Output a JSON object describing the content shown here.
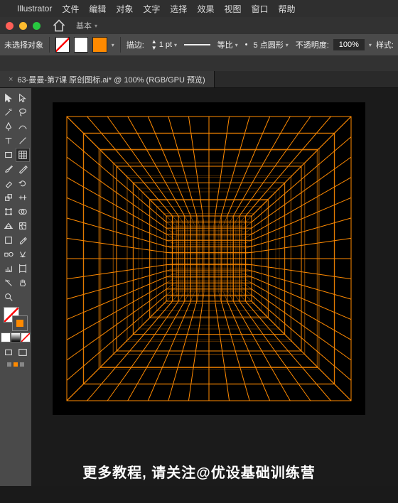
{
  "menubar": {
    "app": "Illustrator",
    "items": [
      "文件",
      "编辑",
      "对象",
      "文字",
      "选择",
      "效果",
      "视图",
      "窗口",
      "帮助"
    ]
  },
  "essentials": {
    "label": "基本"
  },
  "controlbar": {
    "noSelection": "未选择对象",
    "strokeLabel": "描边:",
    "strokeWeight": "1 pt",
    "profileLabel": "等比",
    "brushLabel": "5 点圆形",
    "opacityLabel": "不透明度:",
    "opacityValue": "100%",
    "styleLabel": "样式:"
  },
  "doctab": {
    "close": "×",
    "title": "63-曼曼-第7课 原创图标.ai* @ 100% (RGB/GPU 预览)"
  },
  "caption": "更多教程, 请关注@优设基础训练营",
  "tools": {
    "names": [
      [
        "selection",
        "direct-selection"
      ],
      [
        "magic-wand",
        "lasso"
      ],
      [
        "pen",
        "curvature"
      ],
      [
        "type",
        "line"
      ],
      [
        "rectangle",
        "grid"
      ],
      [
        "paintbrush",
        "pencil"
      ],
      [
        "eraser",
        "rotate"
      ],
      [
        "scale",
        "width"
      ],
      [
        "free-transform",
        "shape-builder"
      ],
      [
        "perspective",
        "mesh"
      ],
      [
        "gradient",
        "eyedropper"
      ],
      [
        "blend",
        "symbol"
      ],
      [
        "graph",
        "artboard"
      ],
      [
        "slice",
        "hand"
      ],
      [
        "zoom",
        "blank"
      ]
    ]
  },
  "colors": {
    "accent": "#ff8a00"
  }
}
